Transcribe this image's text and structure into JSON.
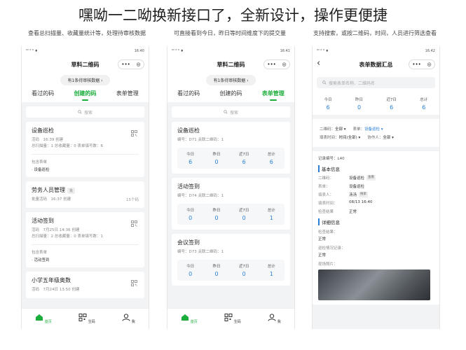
{
  "headline": "嘿呦一二呦换新接口了，全新设计，操作更便捷",
  "captions": [
    "查看总扫描量、收藏量统计等，处理待审核数据",
    "可直接看到今日，昨日等时间维度下的提交量",
    "支持搜索，或按二维码，时间，人员进行筛选查看"
  ],
  "status": {
    "left": "⁰ᴵˡ ⁶ ⁶ ♦",
    "time1": "16:40",
    "time2": "16:41",
    "time3": "16:42"
  },
  "capsule": {
    "dots": "•••",
    "ring": "◎"
  },
  "phone1": {
    "title": "草料二维码",
    "pending": "有1条待审核数据 ›",
    "tabs": [
      "看过的码",
      "创建的码",
      "表单管理"
    ],
    "search": "搜索",
    "cards": [
      {
        "title": "设备巡检",
        "line1": "活码　16:39 创建",
        "line2": "总扫描量：1  总收藏量：0  表单填写数：6",
        "incl": "包含表单",
        "item": "· 设备巡检"
      },
      {
        "title": "劳务人员管理",
        "badge": "批",
        "line1": "批量活码　16:37 创建",
        "count": "15个码"
      },
      {
        "title": "活动签到",
        "line1": "活码　7月25日 14:36 创建",
        "line2": "总扫描量：2  总收藏量：0  表单填写数：1",
        "incl": "包含表单",
        "item": "· 活动签到"
      },
      {
        "title": "小学五年级奥数",
        "line1": "活码　7月24日 13:50 创建"
      }
    ]
  },
  "phone2": {
    "title": "草料二维码",
    "pending": "有1条待审核数据 ›",
    "tabs": [
      "看过的码",
      "创建的码",
      "表单管理"
    ],
    "search": "搜索",
    "stat_labels": [
      "今日",
      "昨日",
      "近7日",
      "总计"
    ],
    "cards": [
      {
        "title": "设备巡检",
        "meta": "编号：D71  关联二维码：1",
        "values": [
          "6",
          "0",
          "6",
          "6"
        ]
      },
      {
        "title": "活动签到",
        "meta": "编号：D74  关联二维码：1",
        "values": [
          "0",
          "0",
          "0",
          "1"
        ]
      },
      {
        "title": "会议签到",
        "meta": "编号：D73  关联二维码：1",
        "values": [
          "0",
          "0",
          "0",
          "1"
        ]
      }
    ]
  },
  "phone3": {
    "title": "表单数据汇总",
    "search": "搜索表单名称、二维码名",
    "stat_labels": [
      "今日",
      "昨日",
      "近7日",
      "总计"
    ],
    "stat_values": [
      "6",
      "0",
      "6",
      "6"
    ],
    "filters": {
      "qr_label": "二维码：",
      "qr_value": "全部 ▾",
      "form_label": "表单：",
      "form_value": "设备巡检 ▾",
      "time_label": "填表时间：",
      "time_value": "时间(全部) ▾",
      "user_label": "协作人：",
      "user_value": "全部 ▾"
    },
    "record_no": "记录编号：L40",
    "basic_h": "基本信息",
    "basic": [
      {
        "k": "二维码：",
        "v": "设备巡检",
        "tag": "查看"
      },
      {
        "k": "表单：",
        "v": "设备巡检"
      },
      {
        "k": "填表人：",
        "v": "汤汤",
        "tag": "搜索"
      },
      {
        "k": "填表时间：",
        "v": "08/13 16:40"
      },
      {
        "k": "检查结果",
        "v": "正常"
      }
    ],
    "detail_h": "详细信息",
    "detail": [
      {
        "k": "检查结果：",
        "v": "正常"
      },
      {
        "k": "巡检情况记录：",
        "v": "正常"
      },
      {
        "k": "现场照片：",
        "v": ""
      }
    ]
  },
  "tabbar": [
    "首页",
    "生码",
    "我"
  ],
  "colors": {
    "accent_green": "#1aad3a",
    "accent_blue": "#2a7fd4"
  }
}
